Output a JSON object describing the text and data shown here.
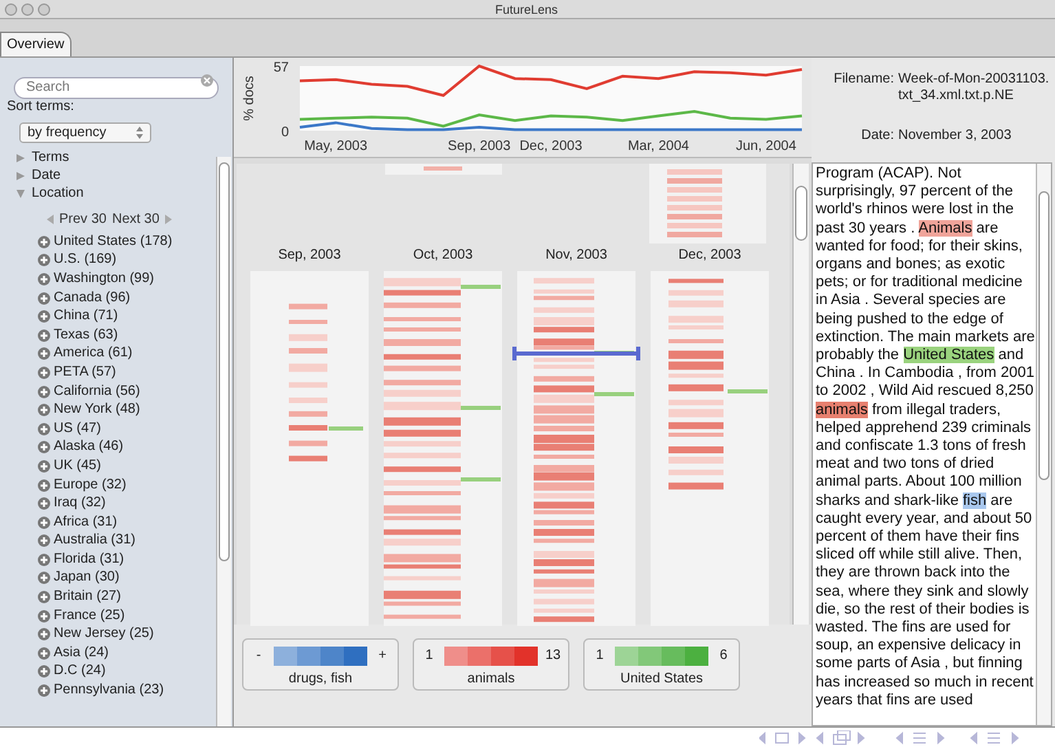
{
  "window": {
    "title": "FutureLens"
  },
  "tabs": [
    {
      "label": "Overview",
      "selected": true
    }
  ],
  "sidebar": {
    "search": {
      "placeholder": "Search"
    },
    "sort_label": "Sort terms:",
    "sort_select": {
      "value": "by frequency"
    },
    "tree": [
      {
        "label": "Terms",
        "expanded": false
      },
      {
        "label": "Date",
        "expanded": false
      },
      {
        "label": "Location",
        "expanded": true,
        "pager": {
          "prev": "Prev 30",
          "next": "Next 30"
        },
        "children": [
          {
            "label": "United States (178)"
          },
          {
            "label": "U.S. (169)"
          },
          {
            "label": "Washington (99)"
          },
          {
            "label": "Canada (96)"
          },
          {
            "label": "China (71)"
          },
          {
            "label": "Texas (63)"
          },
          {
            "label": "America (61)"
          },
          {
            "label": "PETA (57)"
          },
          {
            "label": "California (56)"
          },
          {
            "label": "New York (48)"
          },
          {
            "label": "US (47)"
          },
          {
            "label": "Alaska (46)"
          },
          {
            "label": "UK (45)"
          },
          {
            "label": "Europe (32)"
          },
          {
            "label": "Iraq (32)"
          },
          {
            "label": "Africa (31)"
          },
          {
            "label": "Australia (31)"
          },
          {
            "label": "Florida (31)"
          },
          {
            "label": "Japan (30)"
          },
          {
            "label": "Britain (27)"
          },
          {
            "label": "France (25)"
          },
          {
            "label": "New Jersey (25)"
          },
          {
            "label": "Asia (24)"
          },
          {
            "label": "D.C (24)"
          },
          {
            "label": "Pennsylvania (23)"
          }
        ]
      }
    ]
  },
  "timeline": {
    "chart_data": {
      "type": "line",
      "ylabel": "% docs",
      "categories": [
        null,
        "May, 2003",
        null,
        null,
        null,
        "Sep, 2003",
        null,
        "Dec, 2003",
        null,
        null,
        "Mar, 2004",
        null,
        null,
        "Jun, 2004",
        null
      ],
      "ylim": [
        0,
        57
      ],
      "yticks": [
        0,
        57
      ],
      "series": [
        {
          "color": "#e03c31",
          "values": [
            44,
            45,
            41,
            39,
            31,
            57,
            46,
            45,
            37,
            48,
            46,
            52,
            51,
            49,
            54
          ]
        },
        {
          "color": "#5cb848",
          "values": [
            10,
            11,
            12,
            11,
            4,
            14,
            9,
            13,
            12,
            9,
            13,
            17,
            11,
            10,
            13
          ]
        },
        {
          "color": "#3c78c8",
          "values": [
            3,
            7,
            2,
            1,
            1,
            3,
            1,
            1,
            1,
            1,
            1,
            1,
            1,
            1,
            1
          ]
        }
      ]
    }
  },
  "month_columns": [
    {
      "label": "Sep, 2003"
    },
    {
      "label": "Oct, 2003"
    },
    {
      "label": "Nov, 2003"
    },
    {
      "label": "Dec, 2003"
    }
  ],
  "legends": [
    {
      "min": "-",
      "max": "+",
      "label": "drugs, fish",
      "color": "#2f6fc0"
    },
    {
      "min": "1",
      "max": "13",
      "label": "animals",
      "color": "#e2322a"
    },
    {
      "min": "1",
      "max": "6",
      "label": "United States",
      "color": "#4cb040"
    }
  ],
  "document": {
    "filename_label": "Filename:",
    "filename": "Week-of-Mon-20031103.txt_34.xml.txt.p.NE",
    "date_label": "Date:",
    "date": "November 3, 2003",
    "passage": [
      {
        "text": "Program (ACAP). Not surprisingly, 97 percent of the world's rhinos were lost in the past 30 years . "
      },
      {
        "text": "Animals",
        "color": "#f0a49a"
      },
      {
        "text": " are wanted for food; for their skins, organs and bones; as exotic pets; or for traditional medicine in Asia . Several species are being pushed to the edge of extinction. The main markets are probably the "
      },
      {
        "text": "United States",
        "color": "#9ad37e"
      },
      {
        "text": " and China . In Cambodia , from 2001 to 2002 , Wild Aid rescued 8,250 "
      },
      {
        "text": "animals",
        "color": "#e7806f"
      },
      {
        "text": " from illegal traders, helped apprehend 239 criminals and confiscate 1.3 tons of fresh meat and two tons of dried animal parts. About 100 million sharks and shark-like "
      },
      {
        "text": "fish",
        "color": "#a9c8ee"
      },
      {
        "text": " are caught every year, and about 50 percent of them have their fins sliced off while still alive. Then, they are thrown back into the sea, where they sink and slowly die, so the rest of their bodies is wasted. The fins are used for soup, an expensive delicacy in some parts of Asia , but finning has increased so much in recent years that fins are used"
      }
    ]
  }
}
